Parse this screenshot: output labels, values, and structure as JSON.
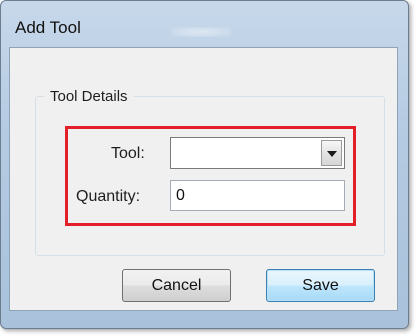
{
  "window": {
    "title": "Add Tool"
  },
  "group": {
    "legend": "Tool Details"
  },
  "fields": {
    "tool_label": "Tool:",
    "tool_value": "",
    "quantity_label": "Quantity:",
    "quantity_value": "0"
  },
  "buttons": {
    "cancel": "Cancel",
    "save": "Save"
  },
  "colors": {
    "highlight_border": "#e3202a",
    "title_bar": "#b5cbe2",
    "client_background": "#f0f0f0",
    "default_button_border": "#3c7fb1"
  },
  "icons": {
    "dropdown": "chevron-down-icon"
  }
}
